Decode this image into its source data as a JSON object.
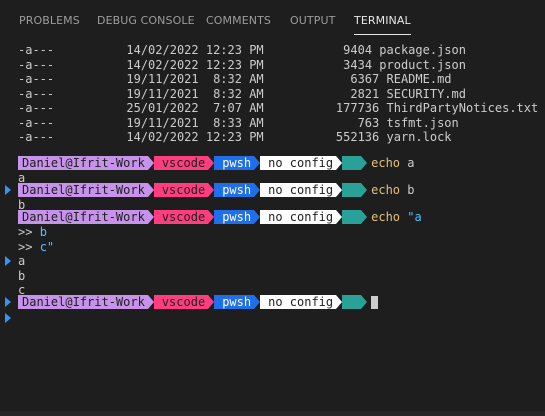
{
  "tabs": [
    {
      "label": "PROBLEMS"
    },
    {
      "label": "DEBUG CONSOLE"
    },
    {
      "label": "COMMENTS"
    },
    {
      "label": "OUTPUT"
    },
    {
      "label": "TERMINAL",
      "active": true
    }
  ],
  "files": [
    {
      "mode": "-a---",
      "date": "14/02/2022",
      "time": "12:23 PM",
      "size": "9404",
      "name": "package.json"
    },
    {
      "mode": "-a---",
      "date": "14/02/2022",
      "time": "12:23 PM",
      "size": "3434",
      "name": "product.json"
    },
    {
      "mode": "-a---",
      "date": "19/11/2021",
      "time": " 8:32 AM",
      "size": "6367",
      "name": "README.md"
    },
    {
      "mode": "-a---",
      "date": "19/11/2021",
      "time": " 8:32 AM",
      "size": "2821",
      "name": "SECURITY.md"
    },
    {
      "mode": "-a---",
      "date": "25/01/2022",
      "time": " 7:07 AM",
      "size": "177736",
      "name": "ThirdPartyNotices.txt"
    },
    {
      "mode": "-a---",
      "date": "19/11/2021",
      "time": " 8:33 AM",
      "size": "763",
      "name": "tsfmt.json"
    },
    {
      "mode": "-a---",
      "date": "14/02/2022",
      "time": "12:23 PM",
      "size": "552136",
      "name": "yarn.lock"
    }
  ],
  "prompt": {
    "user": "Daniel@Ifrit-Work",
    "dir": "vscode",
    "shell": "pwsh",
    "config": "no config"
  },
  "session": {
    "cmd1": "echo",
    "arg1": "a",
    "out1": "a",
    "cmd2": "echo",
    "arg2": "b",
    "out2": "b",
    "cmd3": "echo",
    "arg3": "\"a",
    "cont1_prefix": ">>",
    "cont1_text": "b",
    "cont2_prefix": ">>",
    "cont2_text": "c\"",
    "out3a": "a",
    "out3b": "b",
    "out3c": "c"
  },
  "colors": {
    "user_segment": "#c792ea",
    "dir_segment": "#ff3d7f",
    "shell_segment": "#1f6feb",
    "config_segment": "#ffffff",
    "git_segment": "#2aa198",
    "command": "#e5c07b",
    "string": "#4fc1ff",
    "decoration": "#3794ff"
  }
}
